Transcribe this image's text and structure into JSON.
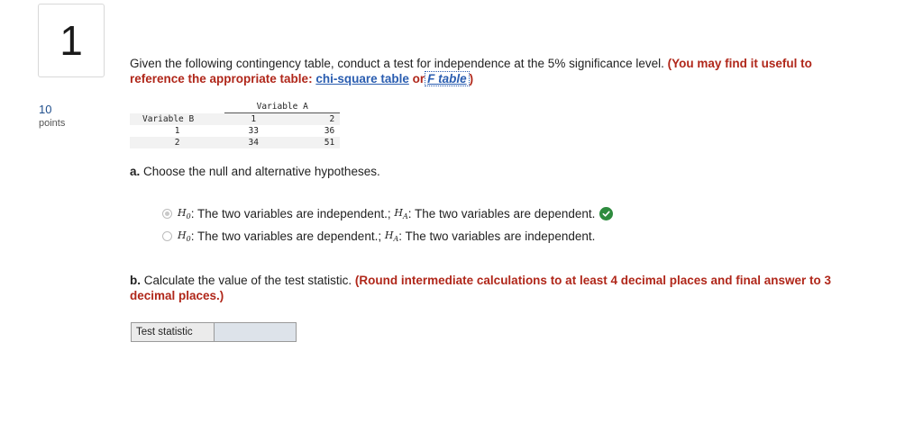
{
  "question": {
    "number": "1",
    "points_value": "10",
    "points_label": "points"
  },
  "prompt": {
    "text": "Given the following contingency table, conduct a test for independence at the 5% significance level.",
    "hint": "(You may find it useful to reference the appropriate table:",
    "chi_link": "chi-square table",
    "or_text": "or",
    "f_link": "F table",
    "close": ")"
  },
  "contingency": {
    "col_header": "Variable A",
    "row_header": "Variable B",
    "col_labels": [
      "1",
      "2"
    ],
    "rows": [
      {
        "label": "1",
        "values": [
          "33",
          "36"
        ]
      },
      {
        "label": "2",
        "values": [
          "34",
          "51"
        ]
      }
    ]
  },
  "part_a": {
    "label": "a.",
    "text": "Choose the null and alternative hypotheses.",
    "options": [
      {
        "h0": "H",
        "h0_sub": "0",
        "h0_text": ": The two variables are independent.;",
        "ha": "H",
        "ha_sub": "A",
        "ha_text": ": The two variables are dependent.",
        "selected": true,
        "correct": true
      },
      {
        "h0": "H",
        "h0_sub": "0",
        "h0_text": ": The two variables are dependent.;",
        "ha": "H",
        "ha_sub": "A",
        "ha_text": ": The two variables are independent.",
        "selected": false,
        "correct": false
      }
    ],
    "correct_color": "#2e8b3e"
  },
  "part_b": {
    "label": "b.",
    "text": "Calculate the value of the test statistic.",
    "hint": "(Round intermediate calculations to at least 4 decimal places and final answer to 3 decimal places.)"
  },
  "test_statistic": {
    "label": "Test statistic",
    "value": ""
  },
  "colors": {
    "accent_red": "#b0271a",
    "link_blue": "#2a5db0",
    "points_blue": "#1f4e8c"
  }
}
